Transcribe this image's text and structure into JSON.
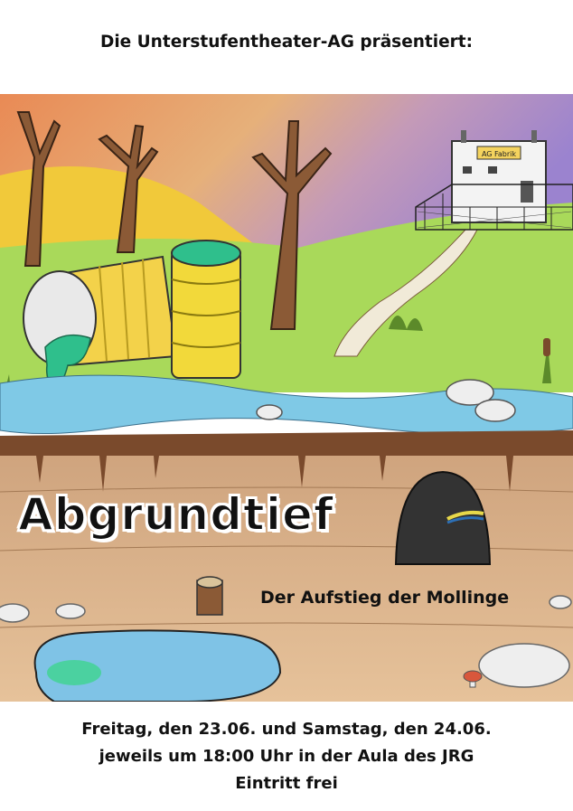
{
  "poster": {
    "presenter": "Die Unterstufentheater-AG präsentiert:",
    "title": "Abgrundtief",
    "subtitle": "Der Aufstieg der Mollinge",
    "dates": "Freitag, den 23.06. und Samstag, den 24.06.",
    "time_place": "jeweils um 18:00 Uhr in der Aula des JRG",
    "admission": "Eintritt frei",
    "factory_sign": "AG Fabrik"
  },
  "colors": {
    "sky_top": "#e9a068",
    "sky_purple": "#a58ec8",
    "grass": "#a7d85a",
    "water": "#7fc9e6",
    "earth": "#d8b08a",
    "topsoil": "#7a4a2c",
    "barrel": "#f2d93a",
    "slime": "#2fbf8c"
  }
}
